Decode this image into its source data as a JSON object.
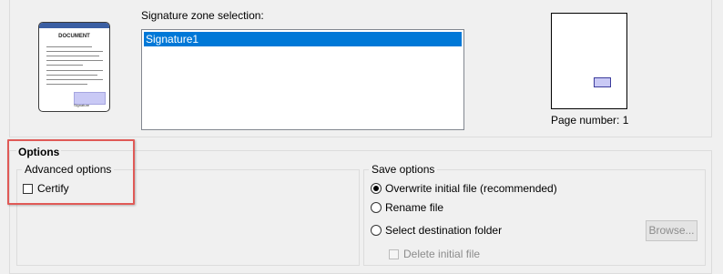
{
  "document_thumb": {
    "title": "DOCUMENT",
    "signature_label": "Signature"
  },
  "signature_zone": {
    "label": "Signature zone selection:",
    "items": [
      "Signature1"
    ],
    "selected": "Signature1"
  },
  "page_preview": {
    "page_number_label": "Page number: 1"
  },
  "options": {
    "title": "Options",
    "advanced": {
      "title": "Advanced options",
      "certify_label": "Certify",
      "certify_checked": false
    },
    "save": {
      "title": "Save options",
      "overwrite_label": "Overwrite initial file (recommended)",
      "rename_label": "Rename file",
      "destination_label": "Select destination folder",
      "browse_label": "Browse...",
      "delete_label": "Delete initial file",
      "selected": "Overwrite initial file (recommended)"
    }
  },
  "colors": {
    "selection": "#0078d7",
    "signature_zone_fill": "#c9c9f5",
    "callout": "#e05a57"
  }
}
